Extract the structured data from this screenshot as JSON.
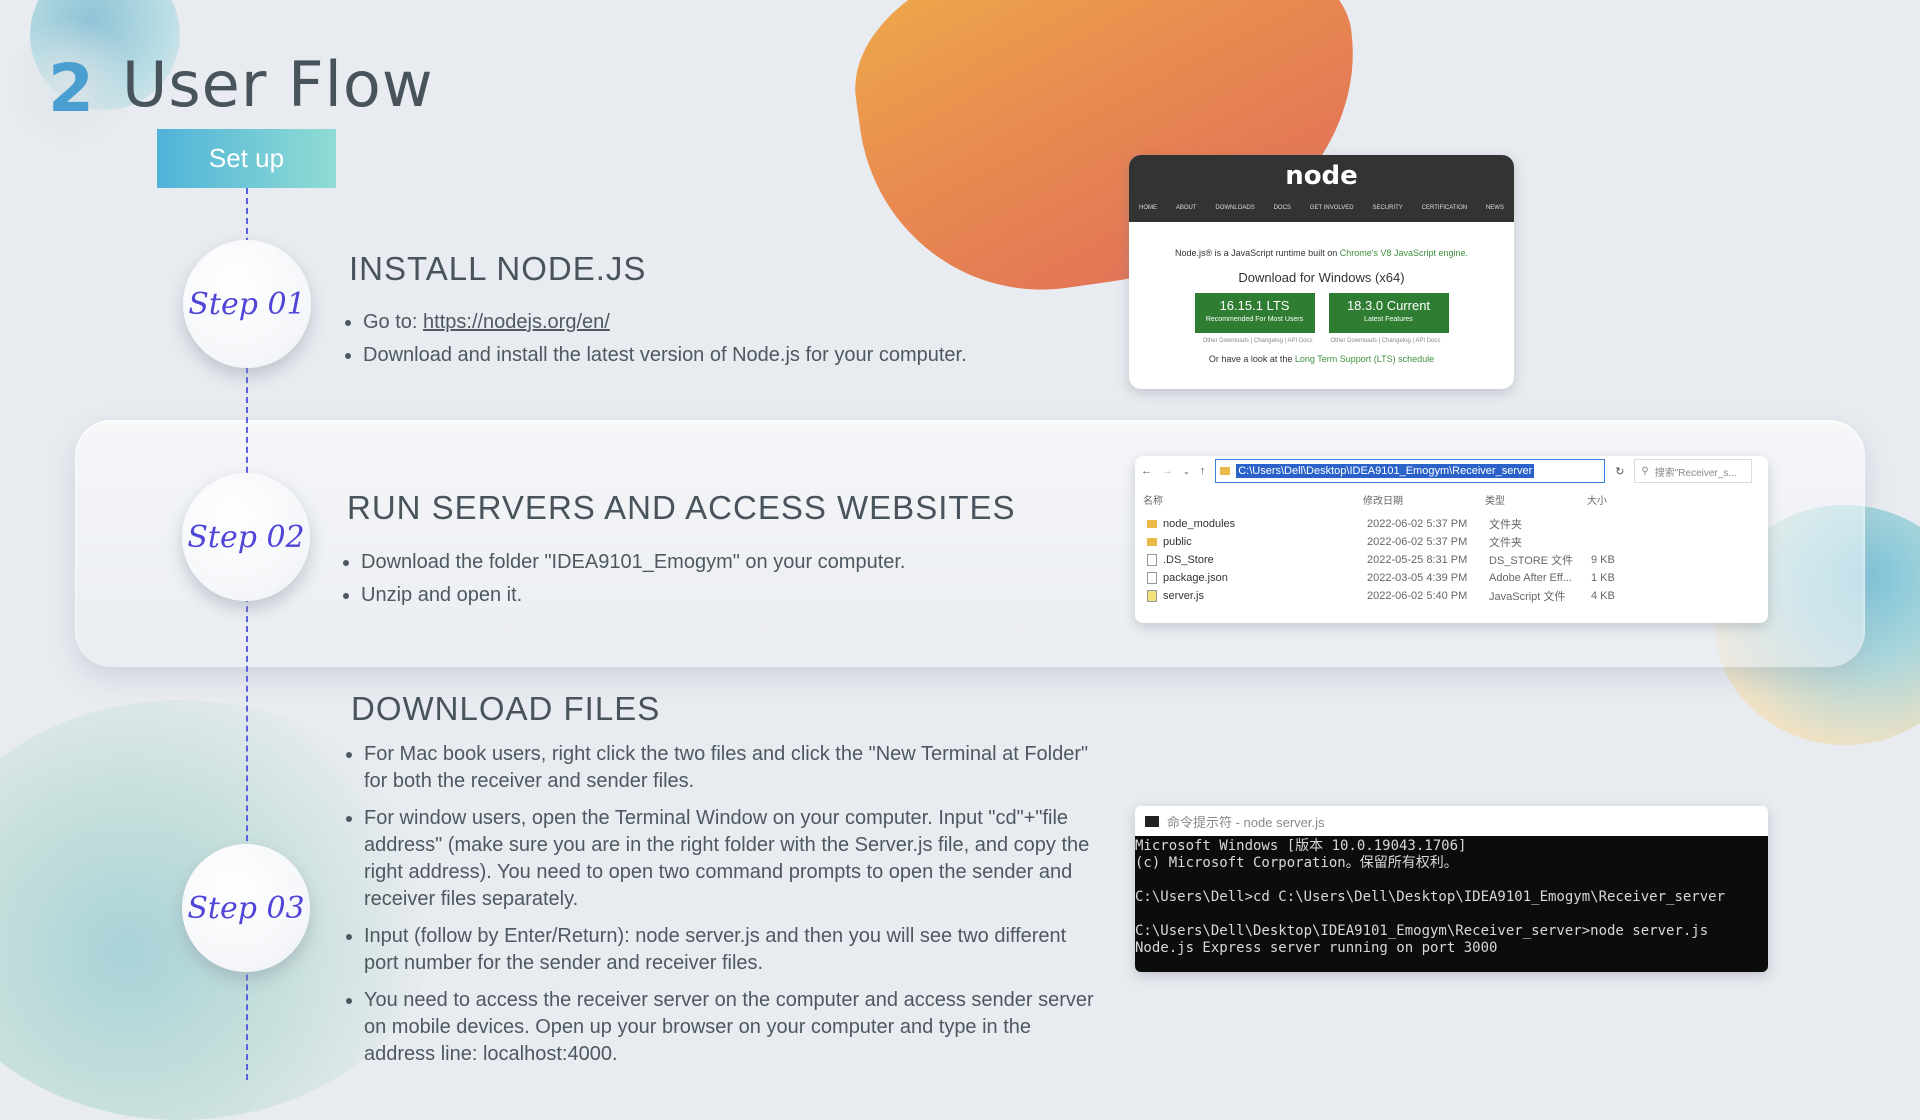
{
  "header": {
    "number": "2",
    "title": "User Flow",
    "badge": "Set up"
  },
  "steps": [
    {
      "label": "Step 01",
      "title": "INSTALL NODE.JS",
      "bullets": {
        "goto_prefix": "Go to: ",
        "goto_link": "https://nodejs.org/en/",
        "b2": "Download and install the latest version of Node.js for your computer."
      }
    },
    {
      "label": "Step 02",
      "title": "RUN SERVERS AND ACCESS WEBSITES",
      "bullets": [
        "Download the folder \"IDEA9101_Emogym\" on your computer.",
        "Unzip and open it."
      ]
    },
    {
      "label": "Step 03",
      "title": "DOWNLOAD FILES",
      "bullets": [
        "For Mac book users, right click the two files and click the \"New Terminal at Folder\" for both the receiver and sender files.",
        "For window users, open the Terminal Window on your computer.  Input \"cd\"+\"file address\" (make sure you are in the right folder with the Server.js file, and copy the right address). You need to open two command prompts to open the sender and receiver files separately.",
        "Input (follow by Enter/Return): node server.js and then you will see two different port number for the sender and receiver files.",
        "You need to access the receiver server on the computer and access sender server on mobile devices. Open up your browser on your computer and type in the address line: localhost:4000."
      ]
    }
  ],
  "node_site": {
    "logo": "node",
    "nav": [
      "HOME",
      "ABOUT",
      "DOWNLOADS",
      "DOCS",
      "GET INVOLVED",
      "SECURITY",
      "CERTIFICATION",
      "NEWS"
    ],
    "tagline_prefix": "Node.js® is a JavaScript runtime built on ",
    "tagline_link": "Chrome's V8 JavaScript engine.",
    "download_title": "Download for Windows (x64)",
    "lts_version": "16.15.1 LTS",
    "lts_sub": "Recommended For Most Users",
    "current_version": "18.3.0 Current",
    "current_sub": "Latest Features",
    "sub_links_left": [
      "Other Downloads",
      "Changelog",
      "API Docs"
    ],
    "sub_links_right": [
      "Other Downloads",
      "Changelog",
      "API Docs"
    ],
    "footer_prefix": "Or have a look at the ",
    "footer_link": "Long Term Support (LTS) schedule"
  },
  "explorer": {
    "path": "C:\\Users\\Dell\\Desktop\\IDEA9101_Emogym\\Receiver_server",
    "search": "搜索\"Receiver_s...",
    "columns": [
      "名称",
      "修改日期",
      "类型",
      "大小"
    ],
    "rows": [
      {
        "name": "node_modules",
        "date": "2022-06-02 5:37 PM",
        "type": "文件夹",
        "size": ""
      },
      {
        "name": "public",
        "date": "2022-06-02 5:37 PM",
        "type": "文件夹",
        "size": ""
      },
      {
        "name": ".DS_Store",
        "date": "2022-05-25 8:31 PM",
        "type": "DS_STORE 文件",
        "size": "9 KB"
      },
      {
        "name": "package.json",
        "date": "2022-03-05 4:39 PM",
        "type": "Adobe After Eff...",
        "size": "1 KB"
      },
      {
        "name": "server.js",
        "date": "2022-06-02 5:40 PM",
        "type": "JavaScript 文件",
        "size": "4 KB"
      }
    ]
  },
  "terminal": {
    "title": "命令提示符 - node  server.js",
    "lines": [
      "Microsoft Windows [版本 10.0.19043.1706]",
      "(c) Microsoft Corporation。保留所有权利。",
      "",
      "C:\\Users\\Dell>cd C:\\Users\\Dell\\Desktop\\IDEA9101_Emogym\\Receiver_server",
      "",
      "C:\\Users\\Dell\\Desktop\\IDEA9101_Emogym\\Receiver_server>node server.js",
      "Node.js Express server running on port 3000"
    ]
  },
  "colors": {
    "accent": "#4a9fd0",
    "step_text": "#4f45d6",
    "dash_line": "#5b5ee0",
    "node_green": "#2f7d32"
  }
}
